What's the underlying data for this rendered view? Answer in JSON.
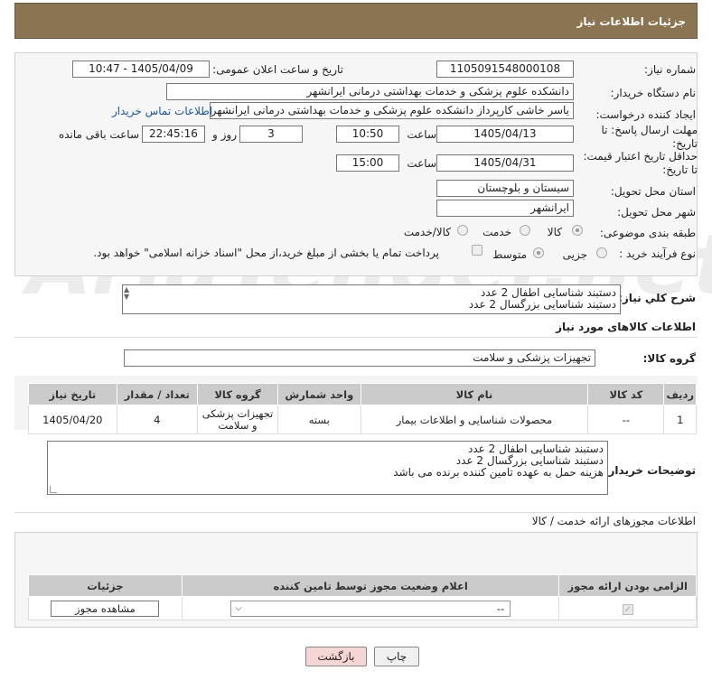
{
  "page": {
    "title": "جزئیات اطلاعات نیاز"
  },
  "form": {
    "need_number_label": "شماره نیاز:",
    "need_number": "1105091548000108",
    "announce_label": "تاریخ و ساعت اعلان عمومی:",
    "announce_value": "1405/04/09 - 10:47",
    "buyer_org_label": "نام دستگاه خریدار:",
    "buyer_org": "دانشکده علوم پزشکی و خدمات بهداشتی درمانی ایرانشهر",
    "requester_label": "ایجاد کننده درخواست:",
    "requester": "یاسر خاشی کارپرداز دانشکده علوم پزشکی و خدمات بهداشتی درمانی ایرانشهر",
    "contact_link": "اطلاعات تماس خریدار",
    "deadline_label": "مهلت ارسال پاسخ: تا تاریخ:",
    "deadline_date": "1405/04/13",
    "time_label": "ساعت",
    "deadline_time": "10:50",
    "days_value": "3",
    "days_label": "روز و",
    "remaining_time": "22:45:16",
    "remaining_label": "ساعت باقی مانده",
    "min_validity_label": "حداقل تاریخ اعتبار قیمت: تا تاریخ:",
    "validity_date": "1405/04/31",
    "validity_time": "15:00",
    "province_label": "استان محل تحویل:",
    "province": "سیستان و بلوچستان",
    "city_label": "شهر محل تحویل:",
    "city": "ایرانشهر",
    "category_label": "طبقه بندی موضوعی:",
    "category_options": [
      "کالا",
      "خدمت",
      "کالا/خدمت"
    ],
    "purchase_type_label": "نوع فرآیند خرید :",
    "purchase_options": [
      "جزیی",
      "متوسط"
    ],
    "treasury_note": "پرداخت تمام یا بخشی از مبلغ خرید،از محل \"اسناد خزانه اسلامی\" خواهد بود."
  },
  "summary": {
    "label": "شرح کلي نياز:",
    "text": "دستبند شناسایی اطفال 2 عدد\nدستبند شناسایی بزرگسال 2 عدد"
  },
  "goods": {
    "section_title": "اطلاعات کالاهای مورد نیاز",
    "group_label": "گروه کالا:",
    "group_value": "تجهیزات پزشکی و سلامت",
    "columns": [
      "ردیف",
      "کد کالا",
      "نام کالا",
      "واحد شمارش",
      "گروه کالا",
      "تعداد / مقدار",
      "تاریخ نیاز"
    ],
    "rows": [
      {
        "row": "1",
        "code": "--",
        "name": "محصولات شناسایی و اطلاعات بیمار",
        "unit": "بسته",
        "group": "تجهیزات پزشکی و سلامت",
        "qty": "4",
        "date": "1405/04/20"
      }
    ],
    "buyer_notes_label": "توضیحات خریدار:",
    "buyer_notes": "دستبند شناسایی اطفال 2 عدد\nدستبند شناسایی بزرگسال 2 عدد\nهزینه حمل به عهده تامین کننده برنده می باشد"
  },
  "licenses": {
    "section_title": "اطلاعات مجوزهای ارائه خدمت / کالا",
    "columns": [
      "الزامی بودن ارائه مجوز",
      "اعلام وضعیت مجوز توسط تامین کننده",
      "جزئیات"
    ],
    "select_value": "--",
    "view_button": "مشاهده مجوز"
  },
  "footer": {
    "print_button": "چاپ",
    "back_button": "بازگشت"
  },
  "watermark": "AriaTender.net",
  "colors": {
    "header": "#8a7452",
    "link": "#1a55a8",
    "back_button_bg": "#f6d5d5"
  }
}
